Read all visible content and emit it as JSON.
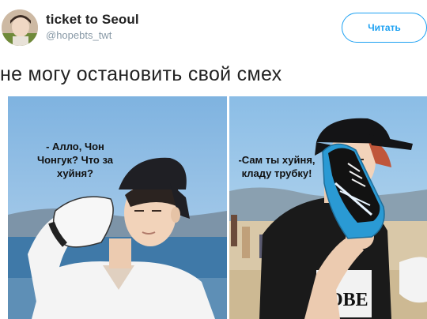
{
  "tweet": {
    "author_name": "ticket to Seoul",
    "author_handle": "@hopebts_twt",
    "follow_label": "Читать",
    "text": "не могу остановить свой смех"
  },
  "meme": {
    "left_caption": "- Алло, Чон\nЧонгук? Что за\nхуйня?",
    "right_caption": "-Сам ты хуйня,\nкладу трубку!"
  },
  "colors": {
    "accent": "#1da1f2",
    "handle": "#8899a6"
  }
}
